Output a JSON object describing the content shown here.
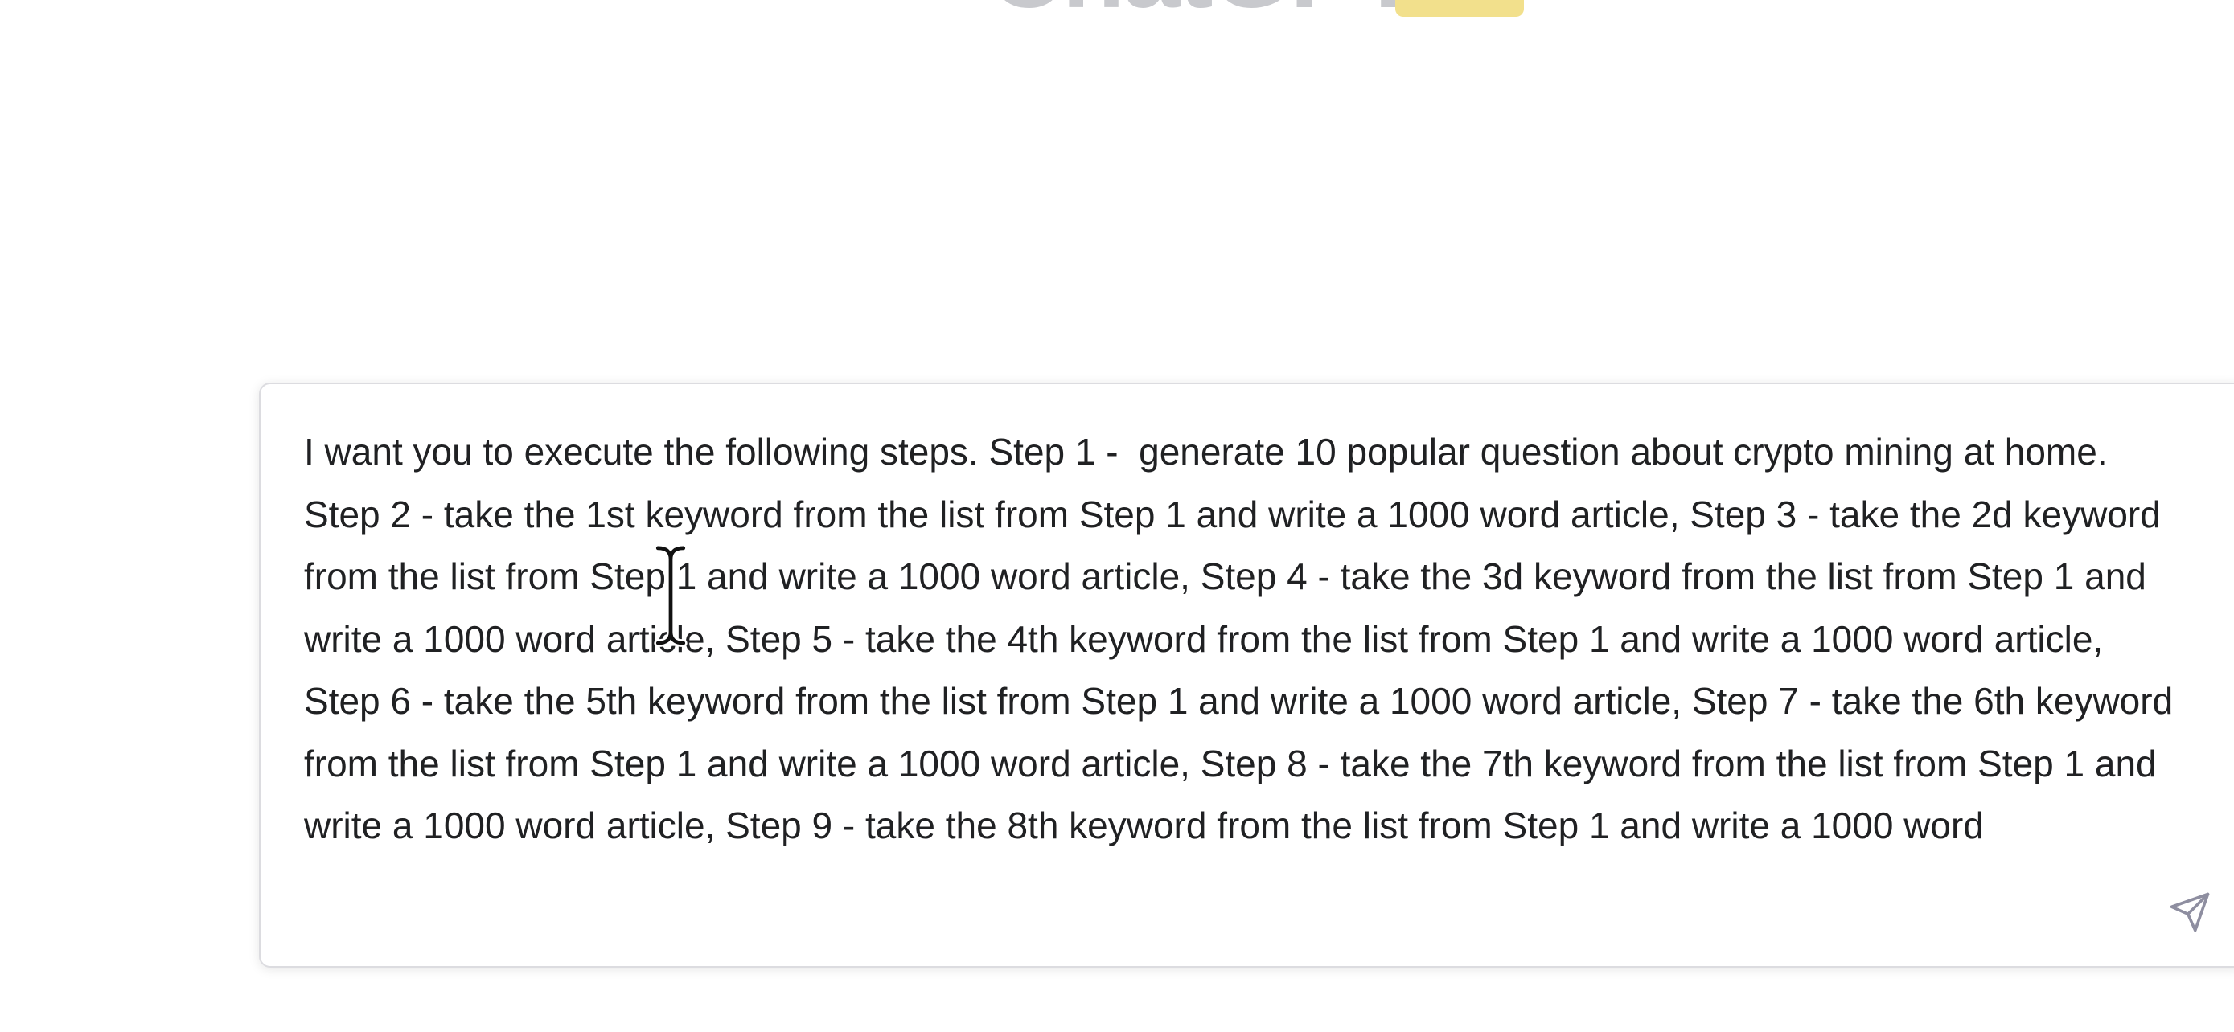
{
  "header": {
    "title": "ChatGPT"
  },
  "prompt": {
    "text": "I want you to execute the following steps. Step 1 -  generate 10 popular question about crypto mining at home.\nStep 2 - take the 1st keyword from the list from Step 1 and write a 1000 word article, Step 3 - take the 2d keyword from the list from Step 1 and write a 1000 word article, Step 4 - take the 3d keyword from the list from Step 1 and write a 1000 word article, Step 5 - take the 4th keyword from the list from Step 1 and write a 1000 word article, Step 6 - take the 5th keyword from the list from Step 1 and write a 1000 word article, Step 7 - take the 6th keyword from the list from Step 1 and write a 1000 word article, Step 8 - take the 7th keyword from the list from Step 1 and write a 1000 word article, Step 9 - take the 8th keyword from the list from Step 1 and write a 1000 word"
  },
  "icons": {
    "send": "send-icon",
    "cursor": "text-cursor-icon"
  },
  "colors": {
    "text": "#202123",
    "badge": "#f2e08c",
    "border": "#dcdce0"
  }
}
